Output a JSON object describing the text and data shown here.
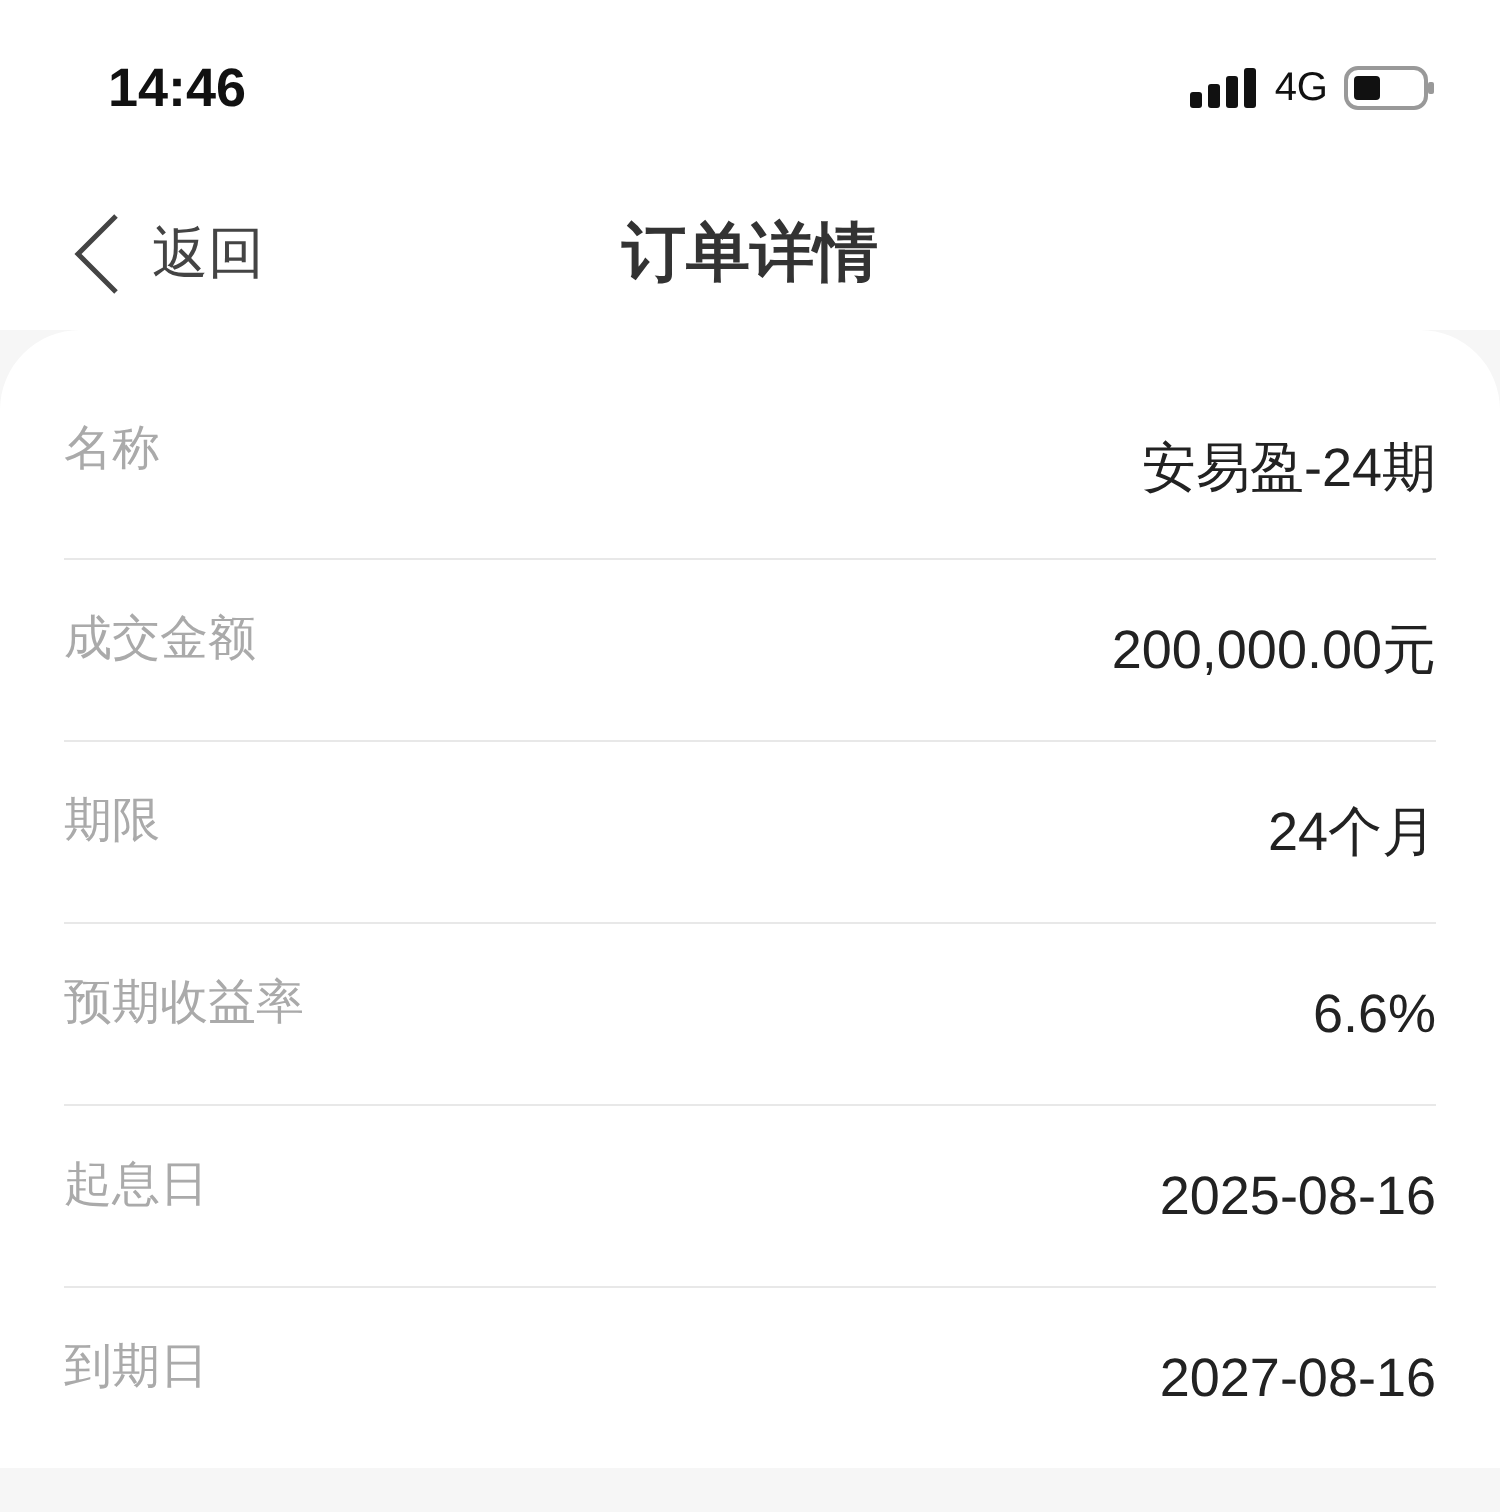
{
  "status_bar": {
    "time": "14:46",
    "network": "4G"
  },
  "nav": {
    "back": "返回",
    "title": "订单详情"
  },
  "rows": [
    {
      "label": "名称",
      "value": "安易盈-24期"
    },
    {
      "label": "成交金额",
      "value": "200,000.00元"
    },
    {
      "label": "期限",
      "value": "24个月"
    },
    {
      "label": "预期收益率",
      "value": "6.6%"
    },
    {
      "label": "起息日",
      "value": "2025-08-16"
    },
    {
      "label": "到期日",
      "value": "2027-08-16"
    }
  ]
}
